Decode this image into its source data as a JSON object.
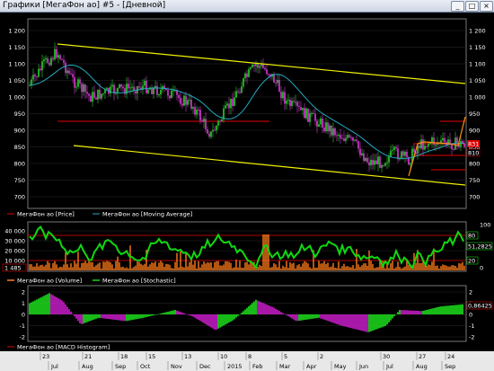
{
  "window": {
    "title": "Графики [МегаФон ао] #5 - [Дневной]",
    "minimize": "_",
    "restore": "□",
    "close": "×"
  },
  "colors": {
    "price_up": "#2dcf2d",
    "price_down": "#d73cd7",
    "moving_average": "#25a9c0",
    "channel": "#f0f000",
    "level": "#e60000",
    "volume": "#ff7a1a",
    "stochastic": "#10d810",
    "macd_up": "#1fe81f",
    "macd_down": "#d21ed2"
  },
  "panels": {
    "price": {
      "yticks": [
        "1 200",
        "1 150",
        "1 100",
        "1 050",
        "1 000",
        "950",
        "900",
        "850",
        "800",
        "750",
        "700"
      ],
      "legend": [
        {
          "label": "МегаФон ао [Price]",
          "icon": "price-legend-icon"
        },
        {
          "label": "МегаФон ао [Moving Average]",
          "icon": "ma-legend-icon"
        }
      ],
      "badges": [
        "831",
        "810"
      ]
    },
    "volume": {
      "yticks_left": [
        "40 000",
        "30 000",
        "20 000",
        "10 000"
      ],
      "yticks_right": [
        "100",
        "50",
        "0"
      ],
      "legend": [
        {
          "label": "МегаФон ао [Volume]",
          "icon": "volume-legend-icon"
        },
        {
          "label": "МегаФон ао [Stochastic]",
          "icon": "stochastic-legend-icon"
        }
      ],
      "badges": {
        "right_top": "80",
        "right_mid": "51,2825",
        "right_bottom": "20",
        "left": "1 485"
      }
    },
    "macd": {
      "yticks": [
        "2",
        "1",
        "0",
        "-1",
        "-2"
      ],
      "legend": [
        {
          "label": "МегаФон ао [MACD Histogram]",
          "icon": "macd-legend-icon"
        }
      ],
      "badge": "0,86425"
    }
  },
  "date_axis": {
    "days": [
      "23",
      "21",
      "18",
      "15",
      "13",
      "10",
      "8",
      "5",
      "2",
      "30",
      "27",
      "24"
    ],
    "months": [
      "Jul",
      "Aug",
      "Sep",
      "Oct",
      "Nov",
      "Dec",
      "2015",
      "Feb",
      "Mar",
      "Apr",
      "May",
      "Jun",
      "Jul",
      "Aug",
      "Sep"
    ]
  }
}
